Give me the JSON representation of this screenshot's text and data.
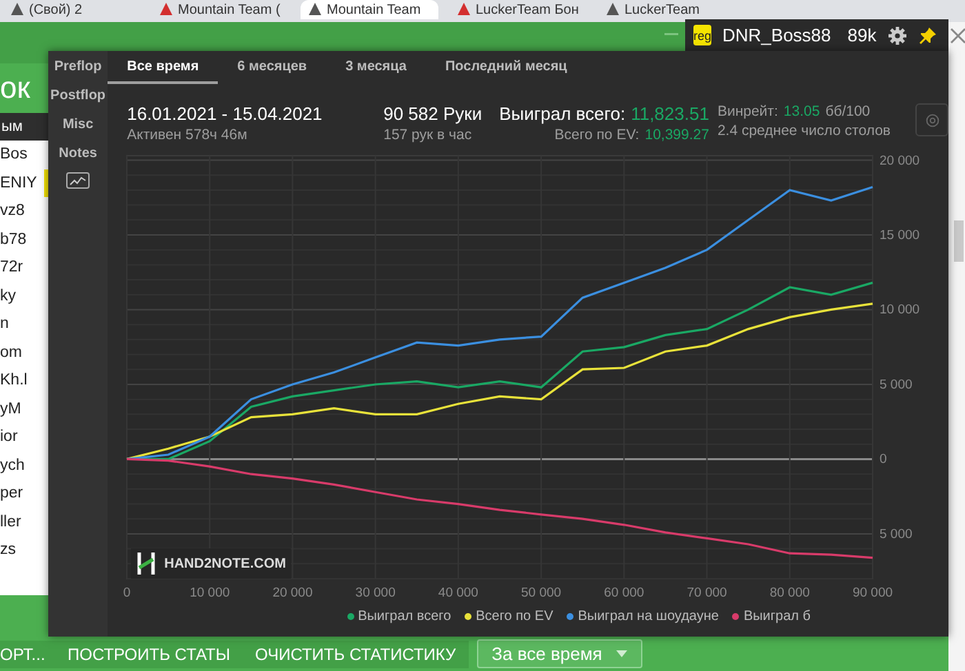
{
  "browser_tabs": [
    {
      "label": "(Свой) 2",
      "selected": false
    },
    {
      "label": "Mountain Team (",
      "selected": false
    },
    {
      "label": "Mountain Team",
      "selected": true
    },
    {
      "label": "LuckerTeam Бон",
      "selected": false
    },
    {
      "label": "LuckerTeam",
      "selected": false
    }
  ],
  "background_app": {
    "banner_text": "ок",
    "list_header": "ым",
    "list_rows": [
      {
        "label": "Bos",
        "selected": false
      },
      {
        "label": "ENIY",
        "selected": true
      },
      {
        "label": "vz8",
        "selected": false
      },
      {
        "label": "b78",
        "selected": false
      },
      {
        "label": "72r",
        "selected": false
      },
      {
        "label": "ky",
        "selected": false
      },
      {
        "label": "n",
        "selected": false
      },
      {
        "label": "om",
        "selected": false
      },
      {
        "label": "Kh.l",
        "selected": false
      },
      {
        "label": "yM",
        "selected": false
      },
      {
        "label": "ior",
        "selected": false
      },
      {
        "label": "ych",
        "selected": false
      },
      {
        "label": "per",
        "selected": false
      },
      {
        "label": "ller",
        "selected": false
      },
      {
        "label": "zs",
        "selected": false
      }
    ],
    "buttons": [
      "ОРТ...",
      "ПОСТРОИТЬ СТАТЫ",
      "ОЧИСТИТЬ СТАТИСТИКУ"
    ],
    "period_dropdown": "За все время"
  },
  "player_panel": {
    "badge": "reg",
    "name": "DNR_Boss88",
    "hands": "89k"
  },
  "sidebar": {
    "items": [
      "Preflop",
      "Postflop",
      "Misc",
      "Notes"
    ]
  },
  "tabs": [
    {
      "label": "Все время",
      "selected": true
    },
    {
      "label": "6 месяцев",
      "selected": false
    },
    {
      "label": "3 месяца",
      "selected": false
    },
    {
      "label": "Последний месяц",
      "selected": false
    }
  ],
  "stats": {
    "date_range": "16.01.2021 - 15.04.2021",
    "active_time": "Активен 578ч 46м",
    "hands": "90 582 Руки",
    "hands_per_hour": "157 рук в час",
    "won_label": "Выиграл всего:",
    "won_value": "11,823.51",
    "ev_label": "Всего по EV:",
    "ev_value": "10,399.27",
    "winrate_label": "Винрейт:",
    "winrate_value": "13.05",
    "winrate_unit": "бб/100",
    "tables": "2.4 среднее число столов"
  },
  "chart": {
    "watermark": "HAND2NOTE.COM",
    "chart_data": {
      "type": "line",
      "x": [
        0,
        5000,
        10000,
        15000,
        20000,
        25000,
        30000,
        35000,
        40000,
        45000,
        50000,
        55000,
        60000,
        65000,
        70000,
        75000,
        80000,
        85000,
        90000
      ],
      "xlim": [
        0,
        90000
      ],
      "grid": true,
      "ylim": [
        -8000,
        20300
      ],
      "xticks": [
        {
          "value": 0,
          "label": "0"
        },
        {
          "value": 10000,
          "label": "10 000"
        },
        {
          "value": 20000,
          "label": "20 000"
        },
        {
          "value": 30000,
          "label": "30 000"
        },
        {
          "value": 40000,
          "label": "40 000"
        },
        {
          "value": 50000,
          "label": "50 000"
        },
        {
          "value": 60000,
          "label": "60 000"
        },
        {
          "value": 70000,
          "label": "70 000"
        },
        {
          "value": 80000,
          "label": "80 000"
        },
        {
          "value": 90000,
          "label": "90 000"
        }
      ],
      "yticks": [
        {
          "value": 20000,
          "label": "20 000"
        },
        {
          "value": 15000,
          "label": "15 000"
        },
        {
          "value": 10000,
          "label": "10 000"
        },
        {
          "value": 5000,
          "label": "5 000"
        },
        {
          "value": 0,
          "label": "0"
        },
        {
          "value": -5000,
          "label": "5 000"
        }
      ],
      "series": [
        {
          "name": "Выиграл всего",
          "color": "#1aa864",
          "values": [
            0,
            0,
            1200,
            3500,
            4200,
            4600,
            5000,
            5200,
            4800,
            5200,
            4800,
            7200,
            7500,
            8300,
            8700,
            10000,
            11500,
            11000,
            11800
          ]
        },
        {
          "name": "Всего по EV",
          "color": "#e8e23a",
          "values": [
            0,
            700,
            1500,
            2800,
            3000,
            3400,
            3000,
            3000,
            3700,
            4200,
            4000,
            6000,
            6100,
            7200,
            7600,
            8700,
            9500,
            10000,
            10400
          ]
        },
        {
          "name": "Выиграл на шоудауне",
          "color": "#3b8fe0",
          "values": [
            0,
            300,
            1500,
            4000,
            5000,
            5800,
            6800,
            7800,
            7600,
            8000,
            8200,
            10800,
            11800,
            12800,
            14000,
            16000,
            18000,
            17300,
            18200
          ]
        },
        {
          "name": "Выиграл б",
          "color": "#d83b6a",
          "values": [
            0,
            -100,
            -500,
            -1000,
            -1300,
            -1700,
            -2200,
            -2700,
            -3000,
            -3400,
            -3700,
            -4000,
            -4400,
            -4900,
            -5300,
            -5700,
            -6300,
            -6400,
            -6600
          ]
        }
      ]
    }
  }
}
